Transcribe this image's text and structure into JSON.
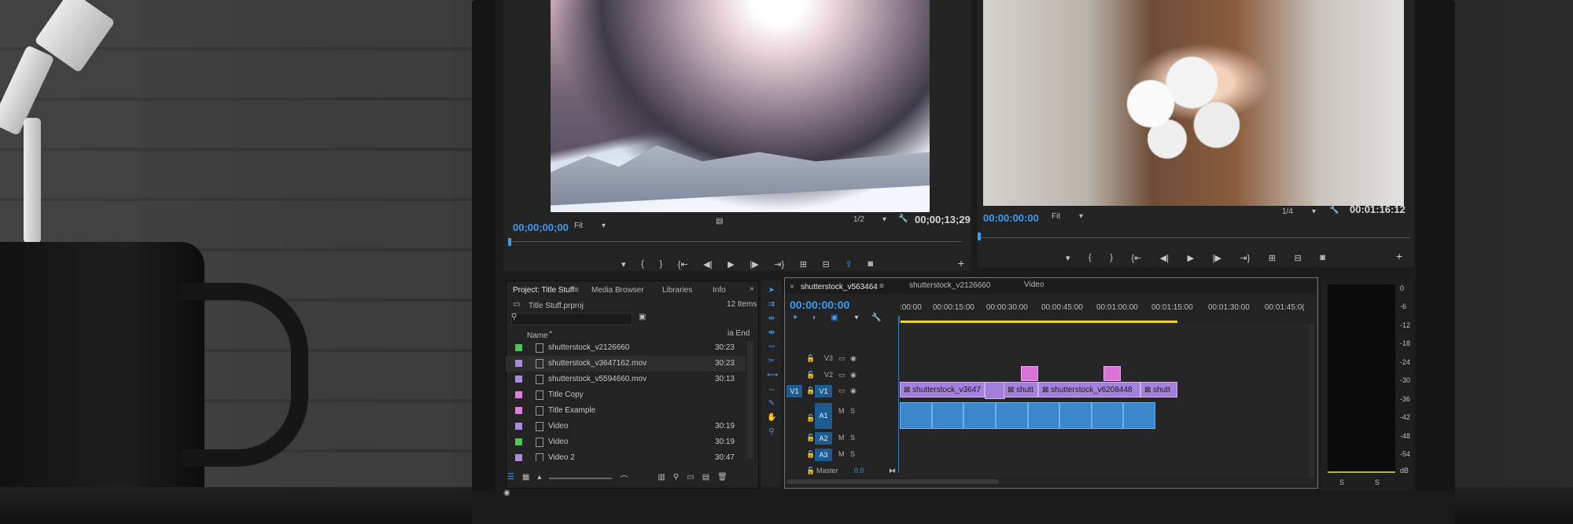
{
  "source_monitor": {
    "timecode_left": "00;00;00;00",
    "fit": "Fit",
    "ratio": "1/2",
    "timecode_right": "00;00;13;29"
  },
  "program_monitor": {
    "timecode_left": "00:00:00:00",
    "fit": "Fit",
    "ratio": "1/4",
    "timecode_right": "00:01:16:12"
  },
  "project_panel": {
    "tabs": [
      "Project: Title Stuff",
      "Media Browser",
      "Libraries",
      "Info"
    ],
    "file": "Title Stuff.prproj",
    "count": "12 Items",
    "col_name": "Name",
    "col_end": "ia End",
    "items": [
      {
        "name": "shutterstock_v2126660",
        "end": "30:23",
        "color": "#4cc64c"
      },
      {
        "name": "shutterstock_v3647162.mov",
        "end": "30:23",
        "color": "#a98be0"
      },
      {
        "name": "shutterstock_v5594660.mov",
        "end": "30:13",
        "color": "#a98be0"
      },
      {
        "name": "Title Copy",
        "end": "",
        "color": "#e07be0"
      },
      {
        "name": "Title Example",
        "end": "",
        "color": "#e07be0"
      },
      {
        "name": "Video",
        "end": "30:19",
        "color": "#a98be0"
      },
      {
        "name": "Video",
        "end": "30:19",
        "color": "#4cc64c"
      },
      {
        "name": "Video 2",
        "end": "30:47",
        "color": "#a98be0"
      }
    ]
  },
  "timeline": {
    "tabs": [
      "shutterstock_v563464",
      "shutterstock_v2126660",
      "Video"
    ],
    "timecode": "00:00:00:00",
    "ruler": [
      ":00:00",
      "00:00:15:00",
      "00:00:30:00",
      "00:00:45:00",
      "00:01:00:00",
      "00:01:15:00",
      "00:01:30:00",
      "00:01:45:0("
    ],
    "tracks": {
      "v3": "V3",
      "v2": "V2",
      "v1": "V1",
      "v1_src": "V1",
      "a1": "A1",
      "a2": "A2",
      "a3": "A3",
      "m": "M",
      "s": "S",
      "master": "Master",
      "master_val": "0.0"
    },
    "clips": {
      "c1": "shutterstock_v3647",
      "c2": "shutt",
      "c3": "shutterstock_v6208448",
      "c4": "shutt"
    }
  },
  "meter": {
    "ticks": [
      "0",
      "-6",
      "-12",
      "-18",
      "-24",
      "-30",
      "-36",
      "-42",
      "-48",
      "-54",
      "dB"
    ],
    "solo_left": "S",
    "solo_right": "S"
  }
}
